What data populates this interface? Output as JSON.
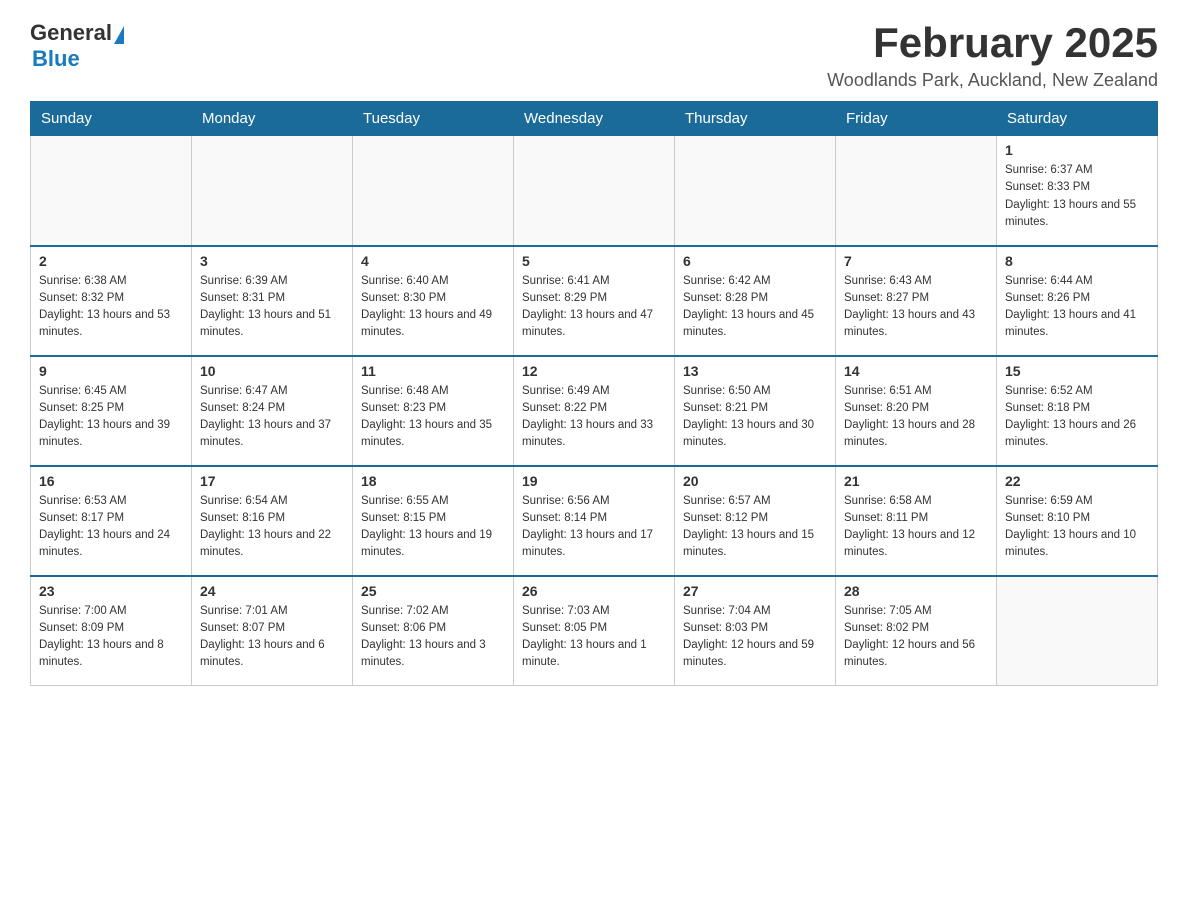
{
  "header": {
    "logo": {
      "part1": "General",
      "part2": "Blue"
    },
    "title": "February 2025",
    "subtitle": "Woodlands Park, Auckland, New Zealand"
  },
  "weekdays": [
    "Sunday",
    "Monday",
    "Tuesday",
    "Wednesday",
    "Thursday",
    "Friday",
    "Saturday"
  ],
  "weeks": [
    [
      {
        "day": "",
        "info": ""
      },
      {
        "day": "",
        "info": ""
      },
      {
        "day": "",
        "info": ""
      },
      {
        "day": "",
        "info": ""
      },
      {
        "day": "",
        "info": ""
      },
      {
        "day": "",
        "info": ""
      },
      {
        "day": "1",
        "info": "Sunrise: 6:37 AM\nSunset: 8:33 PM\nDaylight: 13 hours and 55 minutes."
      }
    ],
    [
      {
        "day": "2",
        "info": "Sunrise: 6:38 AM\nSunset: 8:32 PM\nDaylight: 13 hours and 53 minutes."
      },
      {
        "day": "3",
        "info": "Sunrise: 6:39 AM\nSunset: 8:31 PM\nDaylight: 13 hours and 51 minutes."
      },
      {
        "day": "4",
        "info": "Sunrise: 6:40 AM\nSunset: 8:30 PM\nDaylight: 13 hours and 49 minutes."
      },
      {
        "day": "5",
        "info": "Sunrise: 6:41 AM\nSunset: 8:29 PM\nDaylight: 13 hours and 47 minutes."
      },
      {
        "day": "6",
        "info": "Sunrise: 6:42 AM\nSunset: 8:28 PM\nDaylight: 13 hours and 45 minutes."
      },
      {
        "day": "7",
        "info": "Sunrise: 6:43 AM\nSunset: 8:27 PM\nDaylight: 13 hours and 43 minutes."
      },
      {
        "day": "8",
        "info": "Sunrise: 6:44 AM\nSunset: 8:26 PM\nDaylight: 13 hours and 41 minutes."
      }
    ],
    [
      {
        "day": "9",
        "info": "Sunrise: 6:45 AM\nSunset: 8:25 PM\nDaylight: 13 hours and 39 minutes."
      },
      {
        "day": "10",
        "info": "Sunrise: 6:47 AM\nSunset: 8:24 PM\nDaylight: 13 hours and 37 minutes."
      },
      {
        "day": "11",
        "info": "Sunrise: 6:48 AM\nSunset: 8:23 PM\nDaylight: 13 hours and 35 minutes."
      },
      {
        "day": "12",
        "info": "Sunrise: 6:49 AM\nSunset: 8:22 PM\nDaylight: 13 hours and 33 minutes."
      },
      {
        "day": "13",
        "info": "Sunrise: 6:50 AM\nSunset: 8:21 PM\nDaylight: 13 hours and 30 minutes."
      },
      {
        "day": "14",
        "info": "Sunrise: 6:51 AM\nSunset: 8:20 PM\nDaylight: 13 hours and 28 minutes."
      },
      {
        "day": "15",
        "info": "Sunrise: 6:52 AM\nSunset: 8:18 PM\nDaylight: 13 hours and 26 minutes."
      }
    ],
    [
      {
        "day": "16",
        "info": "Sunrise: 6:53 AM\nSunset: 8:17 PM\nDaylight: 13 hours and 24 minutes."
      },
      {
        "day": "17",
        "info": "Sunrise: 6:54 AM\nSunset: 8:16 PM\nDaylight: 13 hours and 22 minutes."
      },
      {
        "day": "18",
        "info": "Sunrise: 6:55 AM\nSunset: 8:15 PM\nDaylight: 13 hours and 19 minutes."
      },
      {
        "day": "19",
        "info": "Sunrise: 6:56 AM\nSunset: 8:14 PM\nDaylight: 13 hours and 17 minutes."
      },
      {
        "day": "20",
        "info": "Sunrise: 6:57 AM\nSunset: 8:12 PM\nDaylight: 13 hours and 15 minutes."
      },
      {
        "day": "21",
        "info": "Sunrise: 6:58 AM\nSunset: 8:11 PM\nDaylight: 13 hours and 12 minutes."
      },
      {
        "day": "22",
        "info": "Sunrise: 6:59 AM\nSunset: 8:10 PM\nDaylight: 13 hours and 10 minutes."
      }
    ],
    [
      {
        "day": "23",
        "info": "Sunrise: 7:00 AM\nSunset: 8:09 PM\nDaylight: 13 hours and 8 minutes."
      },
      {
        "day": "24",
        "info": "Sunrise: 7:01 AM\nSunset: 8:07 PM\nDaylight: 13 hours and 6 minutes."
      },
      {
        "day": "25",
        "info": "Sunrise: 7:02 AM\nSunset: 8:06 PM\nDaylight: 13 hours and 3 minutes."
      },
      {
        "day": "26",
        "info": "Sunrise: 7:03 AM\nSunset: 8:05 PM\nDaylight: 13 hours and 1 minute."
      },
      {
        "day": "27",
        "info": "Sunrise: 7:04 AM\nSunset: 8:03 PM\nDaylight: 12 hours and 59 minutes."
      },
      {
        "day": "28",
        "info": "Sunrise: 7:05 AM\nSunset: 8:02 PM\nDaylight: 12 hours and 56 minutes."
      },
      {
        "day": "",
        "info": ""
      }
    ]
  ]
}
